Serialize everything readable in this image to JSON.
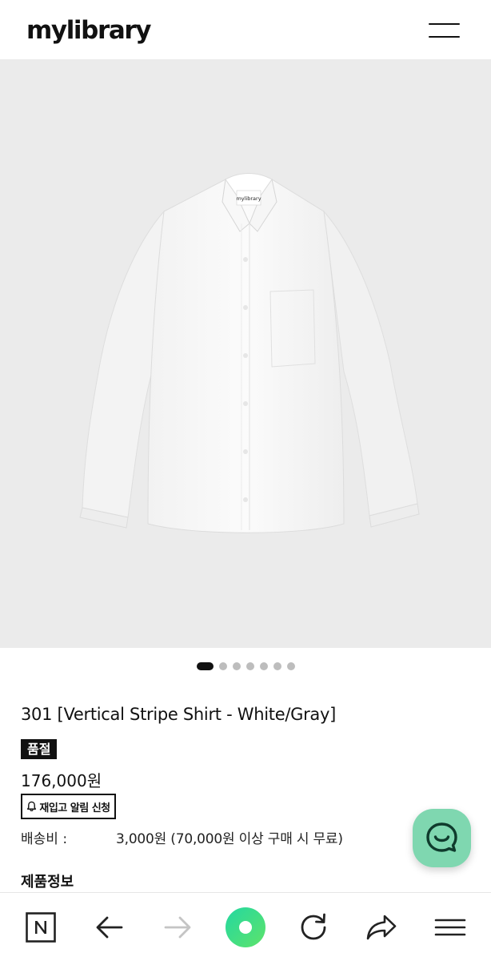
{
  "header": {
    "logo": "mylibrary"
  },
  "gallery": {
    "image_alt": "white shirt product photo",
    "tag_text": "mylibrary",
    "slide_count": 7,
    "active_index": 0
  },
  "product": {
    "title": "301 [Vertical Stripe Shirt - White/Gray]",
    "soldout_badge": "품절",
    "price": "176,000원",
    "restock_button": "재입고 알림 신청",
    "shipping_label": "배송비 :",
    "shipping_value": "3,000원 (70,000원 이상 구매 시 무료)",
    "info_section_title": "제품정보"
  },
  "chat": {
    "icon": "chat-icon",
    "color": "#7fd7b0"
  },
  "bottom_nav": {
    "items": [
      {
        "icon": "naver-n-icon"
      },
      {
        "icon": "back-arrow-icon"
      },
      {
        "icon": "forward-arrow-icon",
        "disabled": true
      },
      {
        "icon": "home-circle-icon",
        "color": "#2fd98a"
      },
      {
        "icon": "refresh-icon"
      },
      {
        "icon": "share-icon"
      },
      {
        "icon": "menu-icon"
      }
    ]
  }
}
